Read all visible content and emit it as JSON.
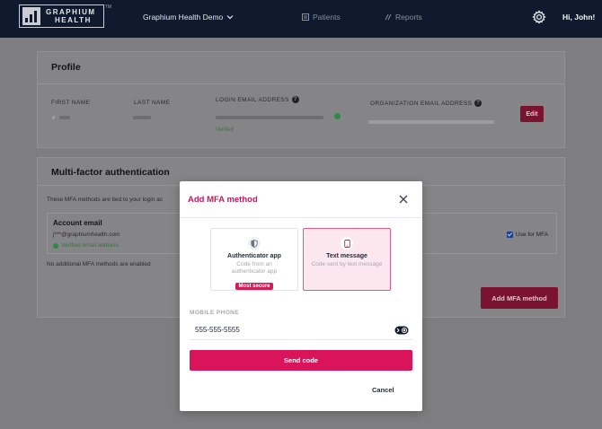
{
  "app": {
    "logo_line1": "GRAPHIUM",
    "logo_line2": "HEALTH",
    "logo_tm": "TM",
    "env_name": "Graphium Health Demo",
    "nav": {
      "patients": "Patients",
      "reports": "Reports"
    },
    "greeting": "Hi, John!"
  },
  "profile": {
    "title": "Profile",
    "labels": {
      "first_name": "FIRST NAME",
      "last_name": "LAST NAME",
      "login_email": "LOGIN EMAIL ADDRESS",
      "org_email": "ORGANIZATION EMAIL ADDRESS"
    },
    "login_email_status": "Verified",
    "edit_label": "Edit"
  },
  "mfa": {
    "title": "Multi-factor authentication",
    "description": "These MFA methods are tied to your login ac",
    "account_email_title": "Account email",
    "account_email_value": "j***@graphiumhealth.com",
    "account_email_status": "Verified email address",
    "use_for_mfa_label": "Use for MFA",
    "use_for_mfa_checked": true,
    "no_methods_msg": "No additional MFA methods are enabled",
    "add_button_label": "Add MFA method"
  },
  "modal": {
    "title": "Add MFA method",
    "options": [
      {
        "id": "authenticator",
        "title": "Authenticator app",
        "subtitle": "Code from an authenticator app",
        "badge": "Most secure",
        "selected": false
      },
      {
        "id": "text",
        "title": "Text message",
        "subtitle": "Code sent by text message",
        "selected": true
      }
    ],
    "phone_label": "MOBILE PHONE",
    "phone_value": "555-555-5555",
    "send_label": "Send code",
    "cancel_label": "Cancel"
  },
  "colors": {
    "nav_bg": "#0f1a2e",
    "accent": "#d9145a",
    "accent_dark_overlay": "#7a1232",
    "selected_option_bg": "#fde7ef",
    "verified_green": "#2e8a45"
  },
  "icons": [
    "logo-bars-icon",
    "chevron-down-icon",
    "patients-icon",
    "reports-icon",
    "gear-icon",
    "help-icon",
    "check-circle-icon",
    "checkbox-icon",
    "close-icon",
    "shield-icon",
    "phone-icon",
    "password-manager-icon"
  ]
}
